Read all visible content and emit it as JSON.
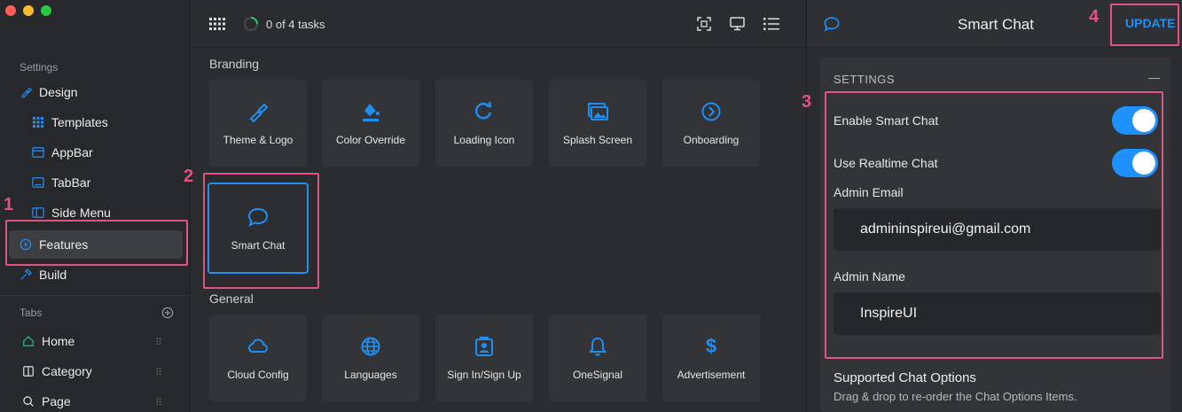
{
  "sidebar": {
    "settings_label": "Settings",
    "items": [
      {
        "label": "Design"
      },
      {
        "label": "Templates"
      },
      {
        "label": "AppBar"
      },
      {
        "label": "TabBar"
      },
      {
        "label": "Side Menu"
      },
      {
        "label": "Features"
      },
      {
        "label": "Build"
      }
    ],
    "tabs_label": "Tabs",
    "tabs": [
      {
        "label": "Home"
      },
      {
        "label": "Category"
      },
      {
        "label": "Page"
      }
    ]
  },
  "topbar": {
    "tasks_text": "0 of 4 tasks"
  },
  "branding": {
    "heading": "Branding",
    "tiles": [
      {
        "label": "Theme & Logo"
      },
      {
        "label": "Color Override"
      },
      {
        "label": "Loading Icon"
      },
      {
        "label": "Splash Screen"
      },
      {
        "label": "Onboarding"
      },
      {
        "label": "Smart Chat"
      }
    ]
  },
  "general": {
    "heading": "General",
    "tiles": [
      {
        "label": "Cloud Config"
      },
      {
        "label": "Languages"
      },
      {
        "label": "Sign In/Sign Up"
      },
      {
        "label": "OneSignal"
      },
      {
        "label": "Advertisement"
      }
    ]
  },
  "panel": {
    "title": "Smart Chat",
    "update_label": "UPDATE",
    "settings_header": "SETTINGS",
    "collapse_glyph": "—",
    "enable_label": "Enable Smart Chat",
    "enable_on": true,
    "realtime_label": "Use Realtime Chat",
    "realtime_on": true,
    "admin_email_label": "Admin Email",
    "admin_email_value": "admininspireui@gmail.com",
    "admin_name_label": "Admin Name",
    "admin_name_value": "InspireUI",
    "supported_title": "Supported Chat Options",
    "supported_desc": "Drag & drop to re-order the Chat Options Items."
  },
  "annotations": [
    "1",
    "2",
    "3",
    "4"
  ],
  "colors": {
    "accent": "#1f8ff0",
    "annotation": "#e0547f",
    "toggle_on": "#1e90ff"
  }
}
